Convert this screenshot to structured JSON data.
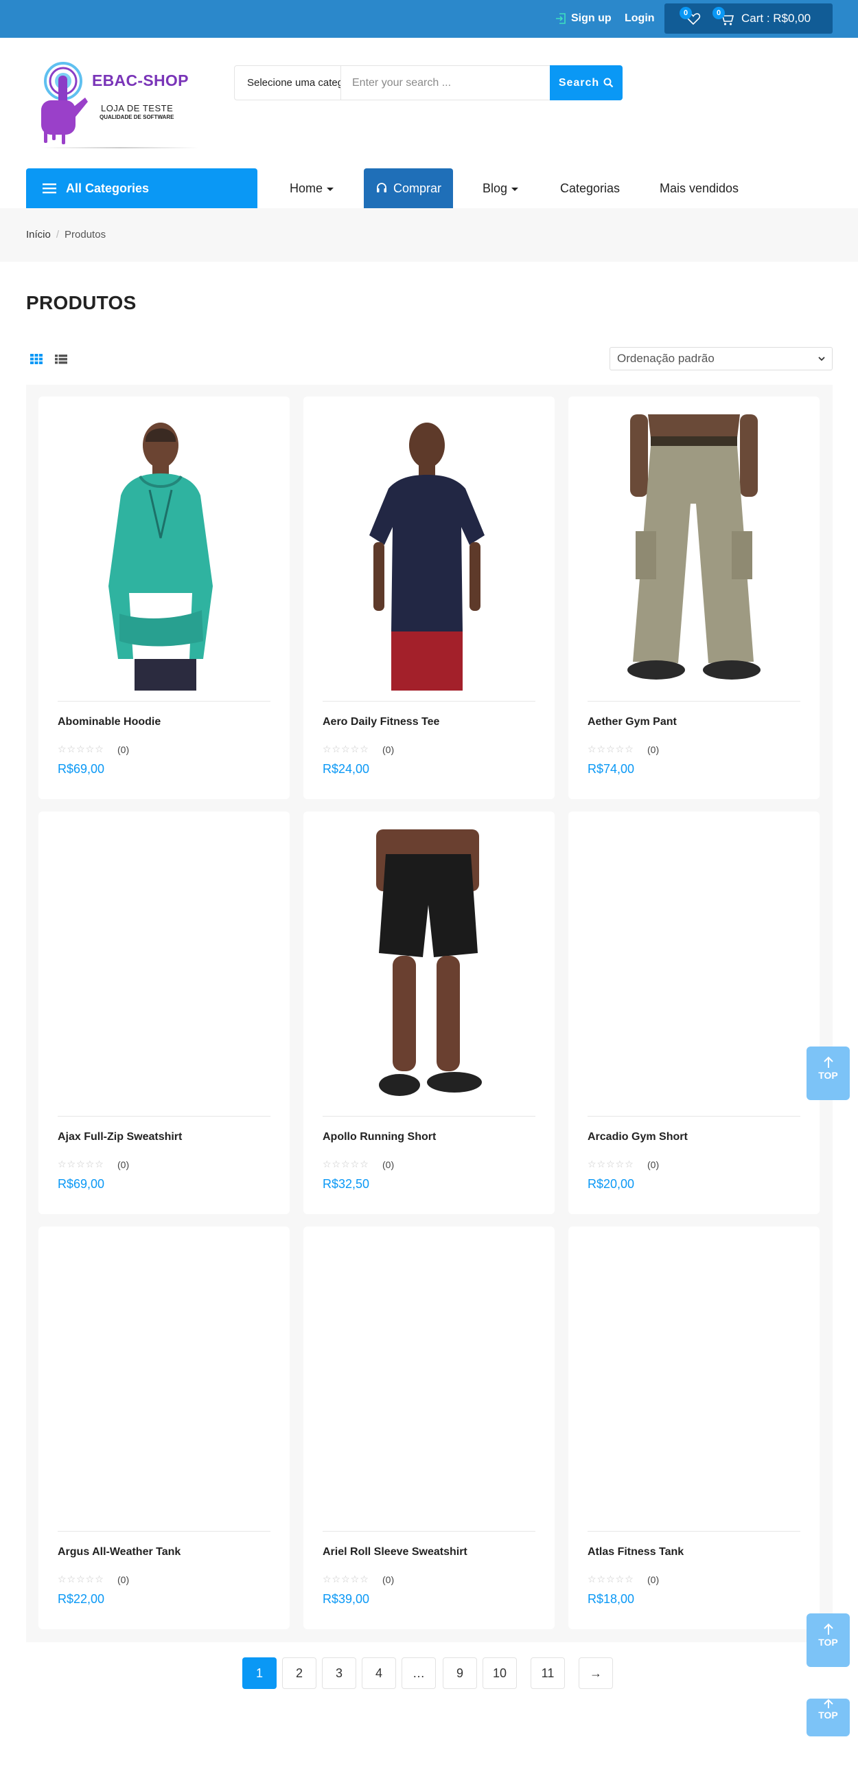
{
  "topbar": {
    "signup_label": "Sign up",
    "login_label": "Login",
    "wishlist_count": "0",
    "cart_count": "0",
    "cart_label": "Cart : R$0,00"
  },
  "logo": {
    "title": "EBAC-SHOP",
    "subtitle": "LOJA DE TESTE",
    "tagline": "QUALIDADE DE SOFTWARE"
  },
  "search": {
    "category_label": "Selecione uma categoria",
    "placeholder": "Enter your search ...",
    "value": "",
    "button_label": "Search"
  },
  "nav": {
    "all_categories": "All Categories",
    "items": [
      "Home",
      "Comprar",
      "Blog",
      "Categorias",
      "Mais vendidos"
    ]
  },
  "breadcrumb": {
    "home": "Início",
    "current": "Produtos"
  },
  "page_title": "PRODUTOS",
  "sort": {
    "selected": "Ordenação padrão"
  },
  "products": [
    {
      "name": "Abominable Hoodie",
      "rating": "☆☆☆☆☆",
      "reviews": "(0)",
      "price": "R$69,00"
    },
    {
      "name": "Aero Daily Fitness Tee",
      "rating": "☆☆☆☆☆",
      "reviews": "(0)",
      "price": "R$24,00"
    },
    {
      "name": "Aether Gym Pant",
      "rating": "☆☆☆☆☆",
      "reviews": "(0)",
      "price": "R$74,00"
    },
    {
      "name": "Ajax Full-Zip Sweatshirt",
      "rating": "☆☆☆☆☆",
      "reviews": "(0)",
      "price": "R$69,00"
    },
    {
      "name": "Apollo Running Short",
      "rating": "☆☆☆☆☆",
      "reviews": "(0)",
      "price": "R$32,50"
    },
    {
      "name": "Arcadio Gym Short",
      "rating": "☆☆☆☆☆",
      "reviews": "(0)",
      "price": "R$20,00"
    },
    {
      "name": "Argus All-Weather Tank",
      "rating": "☆☆☆☆☆",
      "reviews": "(0)",
      "price": "R$22,00"
    },
    {
      "name": "Ariel Roll Sleeve Sweatshirt",
      "rating": "☆☆☆☆☆",
      "reviews": "(0)",
      "price": "R$39,00"
    },
    {
      "name": "Atlas Fitness Tank",
      "rating": "☆☆☆☆☆",
      "reviews": "(0)",
      "price": "R$18,00"
    }
  ],
  "pagination": {
    "pages": [
      "1",
      "2",
      "3",
      "4",
      "…",
      "9",
      "10",
      "11",
      "→"
    ],
    "current": "1"
  },
  "back_to_top": "TOP",
  "colors": {
    "topbar": "#2b88cb",
    "accent": "#0a98f5",
    "comprar": "#1f6fb8",
    "price": "#0a98f5"
  }
}
